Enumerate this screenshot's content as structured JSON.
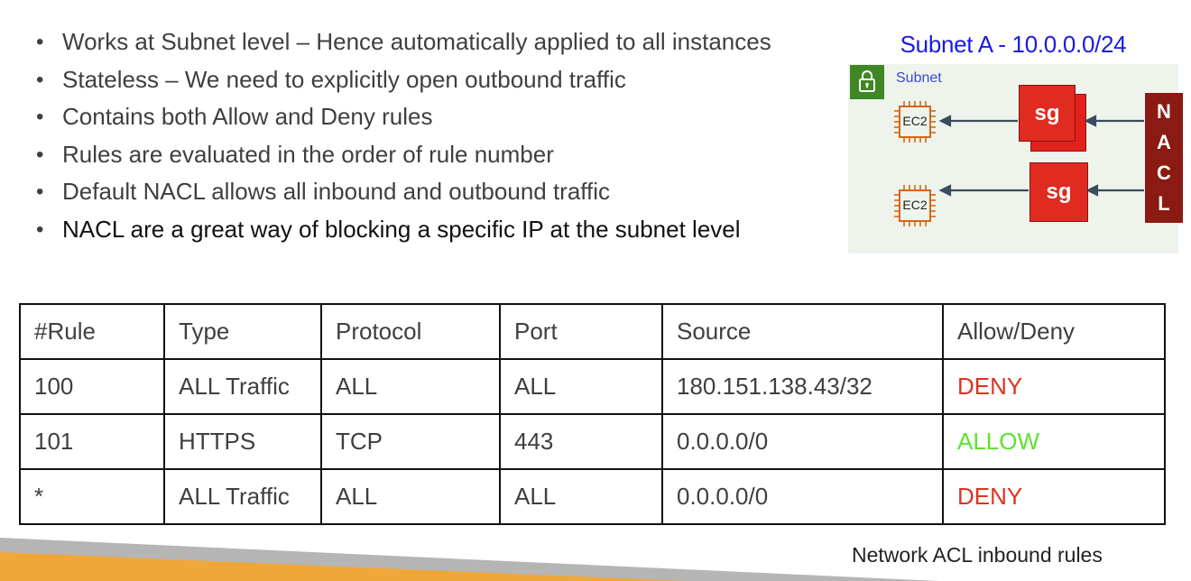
{
  "bullets": [
    "Works at Subnet level – Hence automatically applied to all instances",
    "Stateless – We need to explicitly open outbound traffic",
    "Contains both Allow and Deny rules",
    "Rules are evaluated in the order of rule number",
    "Default NACL allows all inbound and outbound traffic",
    "NACL are a great way of blocking a specific IP at the subnet level"
  ],
  "diagram": {
    "title": "Subnet A - 10.0.0.0/24",
    "subnet_label": "Subnet",
    "ec2_label": "EC2",
    "sg_label": "sg",
    "nacl_letters": [
      "N",
      "A",
      "C",
      "L"
    ],
    "colors": {
      "title": "#1a1ae6",
      "subnet_bg": "#eef4ec",
      "lock_tile": "#3f8624",
      "ec2_chip": "#d86613",
      "sg": "#e02b20",
      "nacl": "#8b1a12",
      "arrow": "#3c4a5e"
    }
  },
  "table": {
    "headers": [
      "#Rule",
      "Type",
      "Protocol",
      "Port",
      "Source",
      "Allow/Deny"
    ],
    "rows": [
      [
        "100",
        "ALL Traffic",
        "ALL",
        "ALL",
        "180.151.138.43/32",
        "DENY"
      ],
      [
        "101",
        "HTTPS",
        "TCP",
        "443",
        "0.0.0.0/0",
        "ALLOW"
      ],
      [
        "*",
        "ALL Traffic",
        "ALL",
        "ALL",
        "0.0.0.0/0",
        "DENY"
      ]
    ],
    "caption": "Network ACL inbound rules",
    "colors": {
      "deny": "#e0321f",
      "allow": "#5ee12f"
    }
  },
  "footer_colors": {
    "orange": "#efa73a",
    "gray": "#b5b5b5"
  }
}
